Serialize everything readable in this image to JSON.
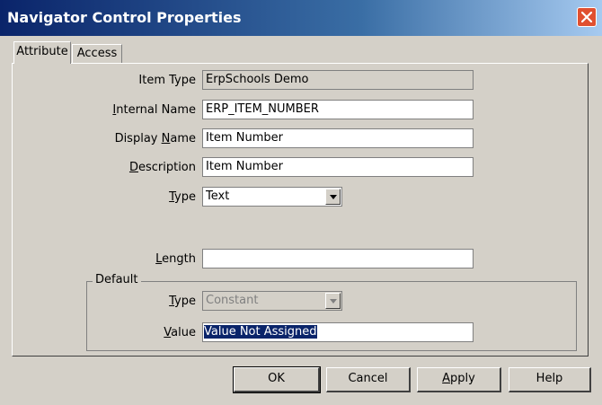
{
  "window": {
    "title": "Navigator Control Properties"
  },
  "tabs": [
    {
      "label": "Attribute"
    },
    {
      "label": "Access"
    }
  ],
  "form": {
    "item_type": {
      "label": "Item Type",
      "value": "ErpSchools Demo"
    },
    "internal_name": {
      "label_key": "I",
      "label_rest": "nternal Name",
      "value": "ERP_ITEM_NUMBER"
    },
    "display_name": {
      "label_pre": "Display ",
      "label_key": "N",
      "label_rest": "ame",
      "value": "Item Number"
    },
    "description": {
      "label_key": "D",
      "label_rest": "escription",
      "value": "Item Number"
    },
    "type": {
      "label_key": "T",
      "label_rest": "ype",
      "value": "Text"
    },
    "length": {
      "label_key": "L",
      "label_rest": "ength",
      "value": ""
    }
  },
  "default": {
    "legend": "Default",
    "type": {
      "label_key": "T",
      "label_rest": "ype",
      "value": "Constant"
    },
    "value": {
      "label_key": "V",
      "label_rest": "alue",
      "value": "Value Not Assigned"
    }
  },
  "buttons": {
    "ok": "OK",
    "cancel": "Cancel",
    "apply_key": "A",
    "apply_rest": "pply",
    "help": "Help"
  },
  "icons": {
    "close": "close-icon",
    "dropdown": "chevron-down-icon"
  }
}
